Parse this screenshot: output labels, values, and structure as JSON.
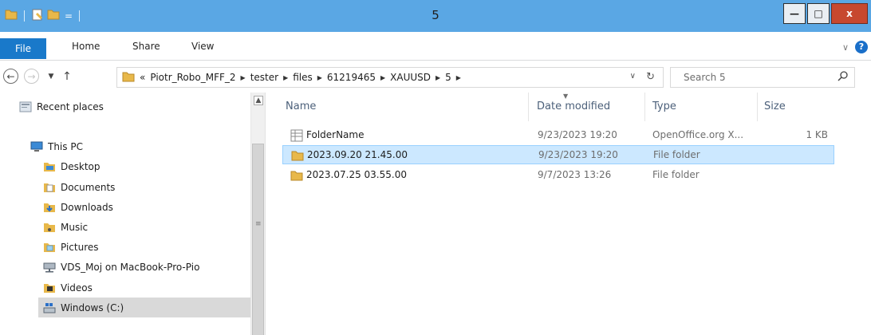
{
  "window": {
    "title": "5",
    "qat_dropdown": "=",
    "controls": {
      "minimize": "—",
      "maximize": "□",
      "close": "x"
    }
  },
  "ribbon": {
    "tabs": [
      "File",
      "Home",
      "Share",
      "View"
    ],
    "expand_chevron": "∨",
    "help": "?"
  },
  "address": {
    "prefix": "«",
    "crumbs": [
      "Piotr_Robo_MFF_2",
      "tester",
      "files",
      "61219465",
      "XAUUSD",
      "5"
    ],
    "dropdown": "∨",
    "refresh": "↻"
  },
  "search": {
    "placeholder": "Search 5"
  },
  "nav": {
    "items": [
      {
        "label": "Recent places",
        "icon": "recent-places-icon"
      },
      {
        "label": "This PC",
        "icon": "this-pc-icon"
      },
      {
        "label": "Desktop",
        "icon": "desktop-folder-icon"
      },
      {
        "label": "Documents",
        "icon": "documents-folder-icon"
      },
      {
        "label": "Downloads",
        "icon": "downloads-folder-icon"
      },
      {
        "label": "Music",
        "icon": "music-folder-icon"
      },
      {
        "label": "Pictures",
        "icon": "pictures-folder-icon"
      },
      {
        "label": "VDS_Moj on MacBook-Pro-Pio",
        "icon": "network-drive-icon"
      },
      {
        "label": "Videos",
        "icon": "videos-folder-icon"
      },
      {
        "label": "Windows (C:)",
        "icon": "drive-icon"
      }
    ]
  },
  "columns": {
    "name": "Name",
    "date": "Date modified",
    "type": "Type",
    "size": "Size"
  },
  "files": [
    {
      "name": "FolderName",
      "date": "9/23/2023 19:20",
      "type": "OpenOffice.org X...",
      "size": "1 KB",
      "icon": "spreadsheet-file-icon"
    },
    {
      "name": "2023.09.20 21.45.00",
      "date": "9/23/2023 19:20",
      "type": "File folder",
      "size": "",
      "icon": "folder-icon"
    },
    {
      "name": "2023.07.25 03.55.00",
      "date": "9/7/2023 13:26",
      "type": "File folder",
      "size": "",
      "icon": "folder-icon"
    }
  ],
  "colors": {
    "titlebar": "#5aa7e4",
    "file_tab": "#1979ca",
    "selection": "#cce8ff",
    "folder": "#e8b84a",
    "close_button": "#c7482f"
  }
}
